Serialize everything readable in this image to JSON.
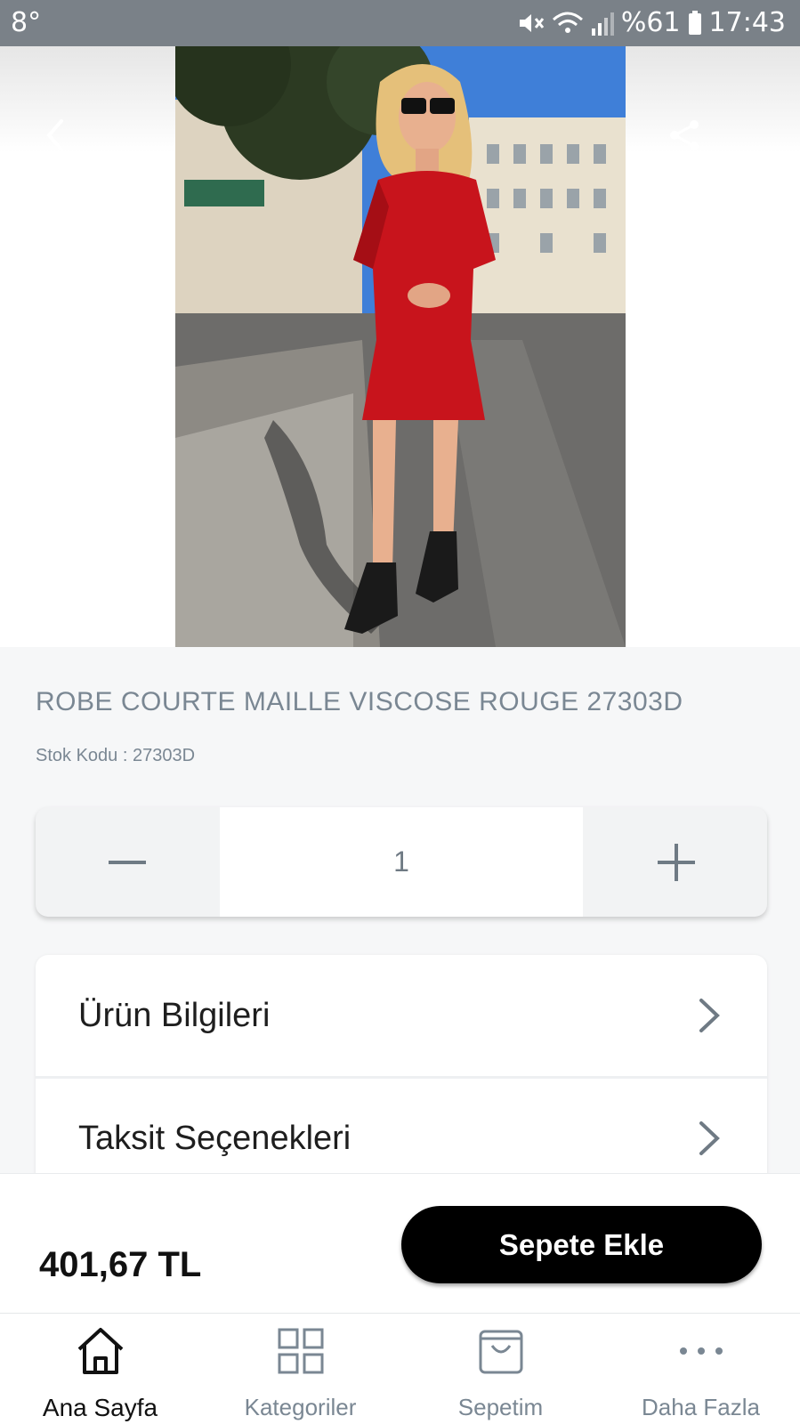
{
  "status_bar": {
    "left_text": "8°",
    "battery": "%61",
    "time": "17:43"
  },
  "product": {
    "title": "ROBE COURTE  MAILLE VISCOSE ROUGE  27303D",
    "sku_label": "Stok Kodu : 27303D",
    "quantity": "1",
    "price": "401,67 TL"
  },
  "info_list": [
    {
      "label": "Ürün Bilgileri"
    },
    {
      "label": "Taksit Seçenekleri"
    }
  ],
  "actions": {
    "add_to_cart": "Sepete Ekle"
  },
  "nav": [
    {
      "label": "Ana Sayfa",
      "icon": "home-icon",
      "active": true
    },
    {
      "label": "Kategoriler",
      "icon": "grid-icon",
      "active": false
    },
    {
      "label": "Sepetim",
      "icon": "bag-icon",
      "active": false
    },
    {
      "label": "Daha Fazla",
      "icon": "more-icon",
      "active": false
    }
  ],
  "colors": {
    "status_bar": "#7a8188",
    "muted_text": "#7a8793",
    "primary_button": "#000000",
    "dress": "#c8141c"
  }
}
